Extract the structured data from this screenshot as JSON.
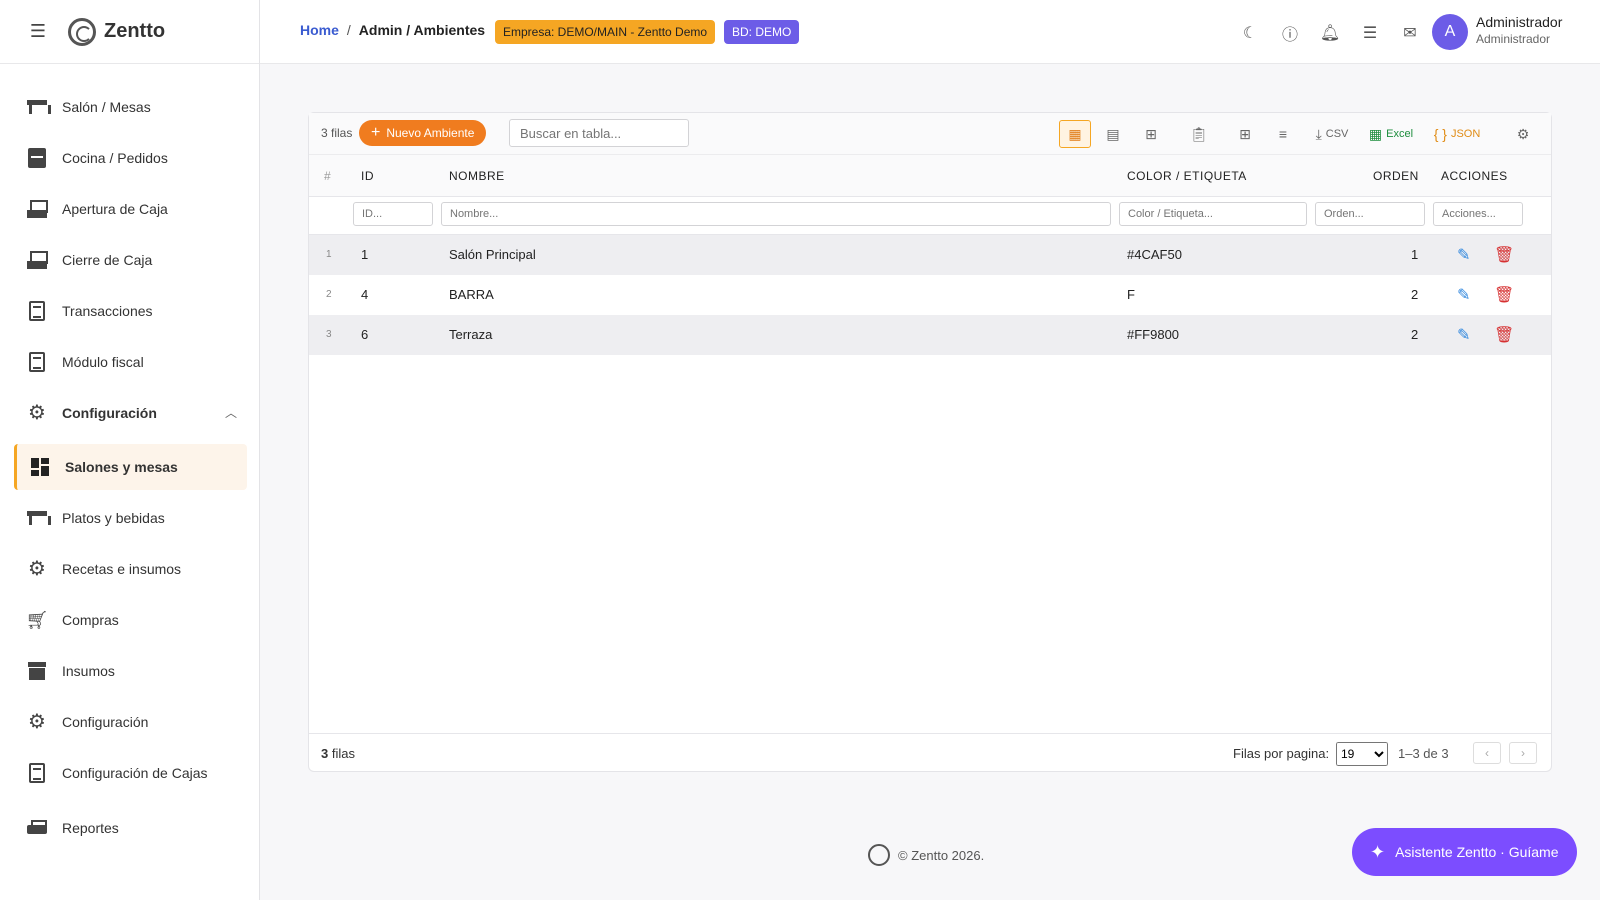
{
  "brand": {
    "name": "Zentto"
  },
  "sidebar": {
    "items": [
      {
        "label": "Salón / Mesas"
      },
      {
        "label": "Cocina / Pedidos"
      },
      {
        "label": "Apertura de Caja"
      },
      {
        "label": "Cierre de Caja"
      },
      {
        "label": "Transacciones"
      },
      {
        "label": "Módulo fiscal"
      },
      {
        "label": "Configuración"
      },
      {
        "label": "Salones y mesas"
      },
      {
        "label": "Platos y bebidas"
      },
      {
        "label": "Recetas e insumos"
      },
      {
        "label": "Compras"
      },
      {
        "label": "Insumos"
      },
      {
        "label": "Configuración"
      },
      {
        "label": "Configuración de Cajas"
      },
      {
        "label": "Reportes"
      }
    ]
  },
  "header": {
    "breadcrumb_home": "Home",
    "breadcrumb_sep": "/",
    "breadcrumb_current": "Admin / Ambientes",
    "badge_empresa": "Empresa: DEMO/MAIN - Zentto Demo",
    "badge_bd": "BD: DEMO",
    "avatar_letter": "A",
    "user_name": "Administrador",
    "user_role": "Administrador"
  },
  "toolbar": {
    "rows_count": "3 filas",
    "new_label": "Nuevo Ambiente",
    "search_placeholder": "Buscar en tabla...",
    "csv_label": "CSV",
    "excel_label": "Excel",
    "json_label": "JSON"
  },
  "table": {
    "columns": [
      "#",
      "ID",
      "NOMBRE",
      "COLOR / ETIQUETA",
      "ORDEN",
      "ACCIONES"
    ],
    "filters": [
      "ID...",
      "Nombre...",
      "Color / Etiqueta...",
      "Orden...",
      "Acciones..."
    ],
    "rows": [
      {
        "n": "1",
        "id": "1",
        "nombre": "Salón Principal",
        "color": "#4CAF50",
        "orden": "1"
      },
      {
        "n": "2",
        "id": "4",
        "nombre": "BARRA",
        "color": "F",
        "orden": "2"
      },
      {
        "n": "3",
        "id": "6",
        "nombre": "Terraza",
        "color": "#FF9800",
        "orden": "2"
      }
    ]
  },
  "pagination": {
    "count": "3",
    "count_suffix": "filas",
    "per_page_label": "Filas por pagina:",
    "per_page_value": "19",
    "range": "1–3 de 3",
    "prev": "‹",
    "next": "›"
  },
  "footer": {
    "copyright": "© Zentto 2026."
  },
  "assistant": {
    "label": "Asistente Zentto · Guíame"
  },
  "colors": {
    "accent": "#f07c1f",
    "badge_empresa": "#f5a623",
    "badge_bd": "#6c5ce7",
    "assistant": "#7c4dff",
    "link": "#3a5bd0"
  }
}
